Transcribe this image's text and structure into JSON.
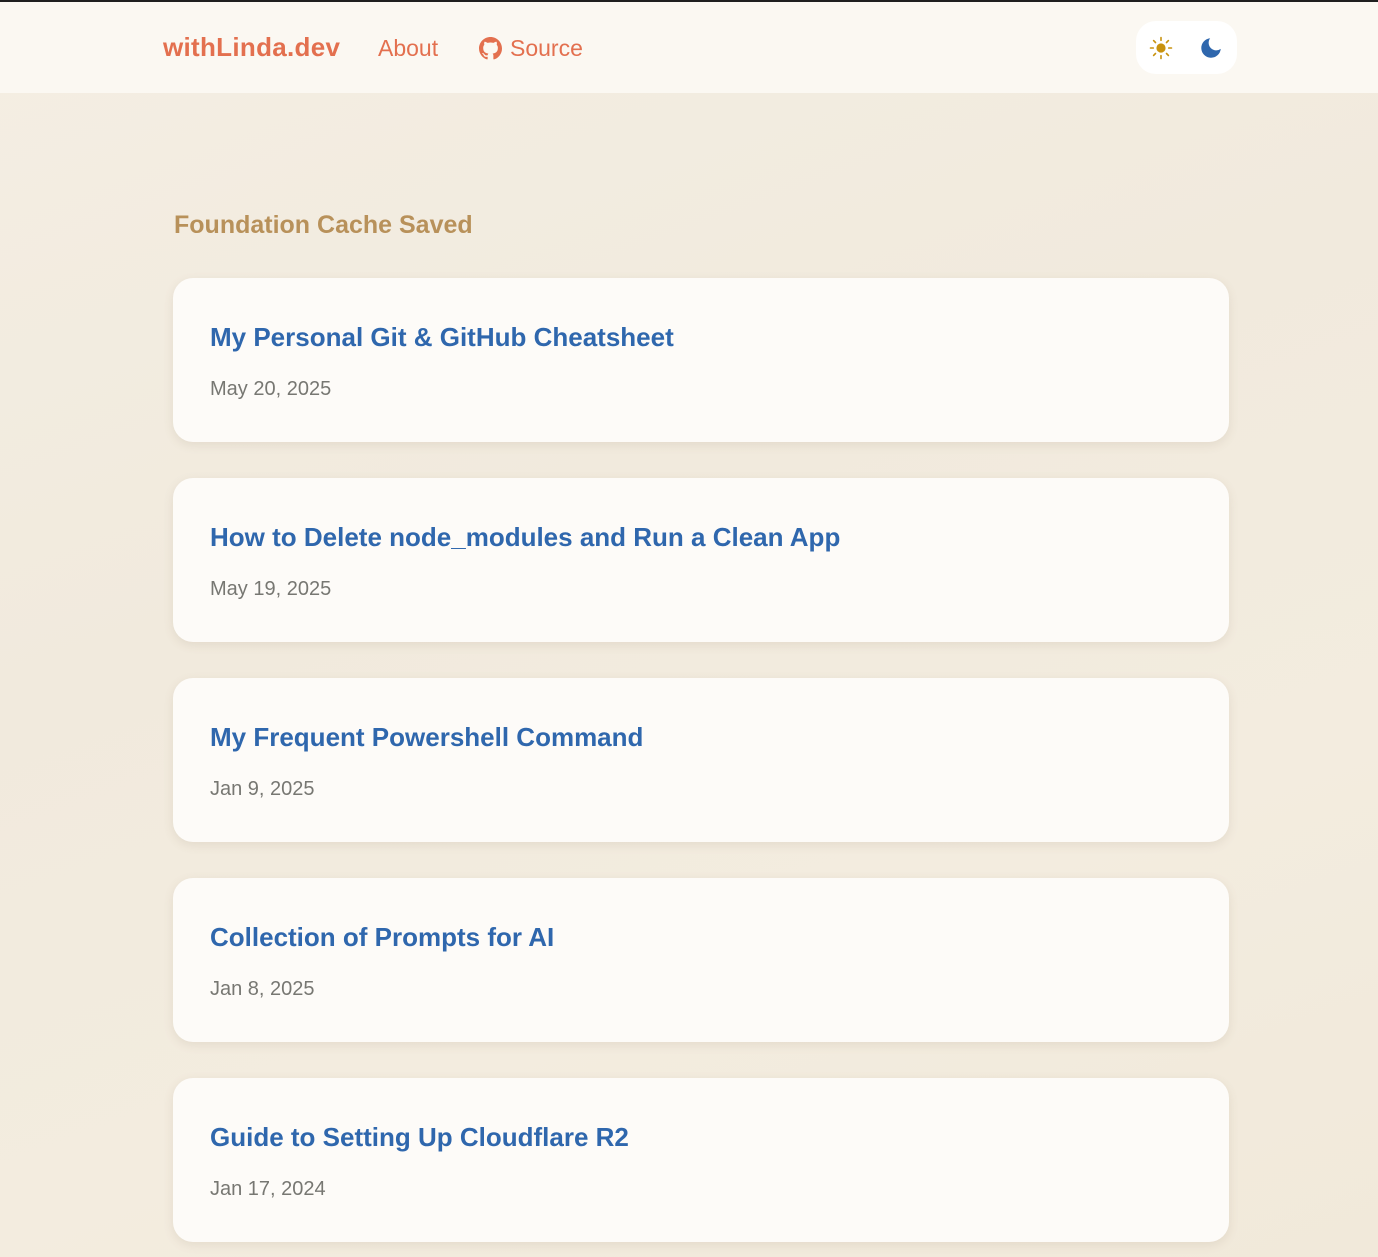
{
  "header": {
    "brand": "withLinda.dev",
    "nav": {
      "about": "About",
      "source": "Source"
    },
    "theme_toggle": {
      "light_icon": "sun-icon",
      "dark_icon": "moon-icon"
    }
  },
  "main": {
    "section_title": "Foundation Cache Saved",
    "posts": [
      {
        "title": "My Personal Git & GitHub Cheatsheet",
        "date": "May 20, 2025"
      },
      {
        "title": "How to Delete node_modules and Run a Clean App",
        "date": "May 19, 2025"
      },
      {
        "title": "My Frequent Powershell Command",
        "date": "Jan 9, 2025"
      },
      {
        "title": "Collection of Prompts for AI",
        "date": "Jan 8, 2025"
      },
      {
        "title": "Guide to Setting Up Cloudflare R2",
        "date": "Jan 17, 2024"
      }
    ]
  },
  "colors": {
    "brand": "#e3704f",
    "section_title": "#b8915a",
    "post_title": "#2f67ad",
    "date": "#777772",
    "sun": "#c8920f",
    "moon": "#2f67ad"
  }
}
